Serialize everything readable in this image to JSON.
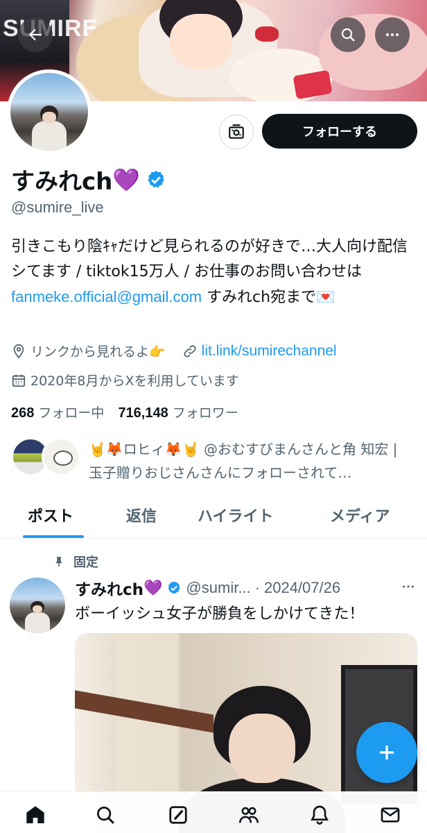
{
  "colors": {
    "accent": "#1d9bf0",
    "text_primary": "#0f1419",
    "text_secondary": "#536471",
    "heart": "#9b4de0",
    "follow_button_bg": "#0f1419"
  },
  "header": {
    "back_icon": "arrow-left-icon",
    "search_icon": "search-icon",
    "more_icon": "more-horizontal-icon",
    "banner_sign_text": "SUMIRE"
  },
  "profile": {
    "display_name": "すみれch",
    "name_emoji": "💜",
    "verified_icon": "verified-badge-icon",
    "handle": "@sumire_live",
    "follow_label": "フォローする",
    "snapshot_icon": "subscribe-icon",
    "bio_part1": "引きこもり陰ｷｬだけど見られるのが好きで…大人向け配信シてます / tiktok15万人 / お仕事のお問い合わせは ",
    "bio_email": "fanmeke.official@gmail.com",
    "bio_part2": " すみれch宛まで💌",
    "location": "リンクから見れるよ👉",
    "website": "lit.link/sumirechannel",
    "joined": "2020年8月からXを利用しています",
    "following_count": "268",
    "following_label": "フォロー中",
    "followers_count": "716,148",
    "followers_label": "フォロワー",
    "followed_by_text": "🤘🦊ロヒィ🦊🤘 @おむすびまんさんと角 知宏 | 玉子贈りおじさんさんにフォローされて…"
  },
  "tabs": [
    {
      "label": "ポスト",
      "active": true
    },
    {
      "label": "返信",
      "active": false
    },
    {
      "label": "ハイライト",
      "active": false
    },
    {
      "label": "メディア",
      "active": false
    }
  ],
  "pinned_post": {
    "pinned_label": "固定",
    "author_name": "すみれch",
    "author_emoji": "💜",
    "author_handle": "@sumir...",
    "separator": "·",
    "date": "2024/07/26",
    "text": "ボーイッシュ女子が勝負をしかけてきた！"
  },
  "fab_icon": "compose-plus-icon",
  "bottom_nav": [
    {
      "name": "home-icon",
      "active": true
    },
    {
      "name": "search-icon",
      "active": false
    },
    {
      "name": "grok-icon",
      "active": false
    },
    {
      "name": "communities-icon",
      "active": false
    },
    {
      "name": "notifications-icon",
      "active": false
    },
    {
      "name": "messages-icon",
      "active": false
    }
  ]
}
